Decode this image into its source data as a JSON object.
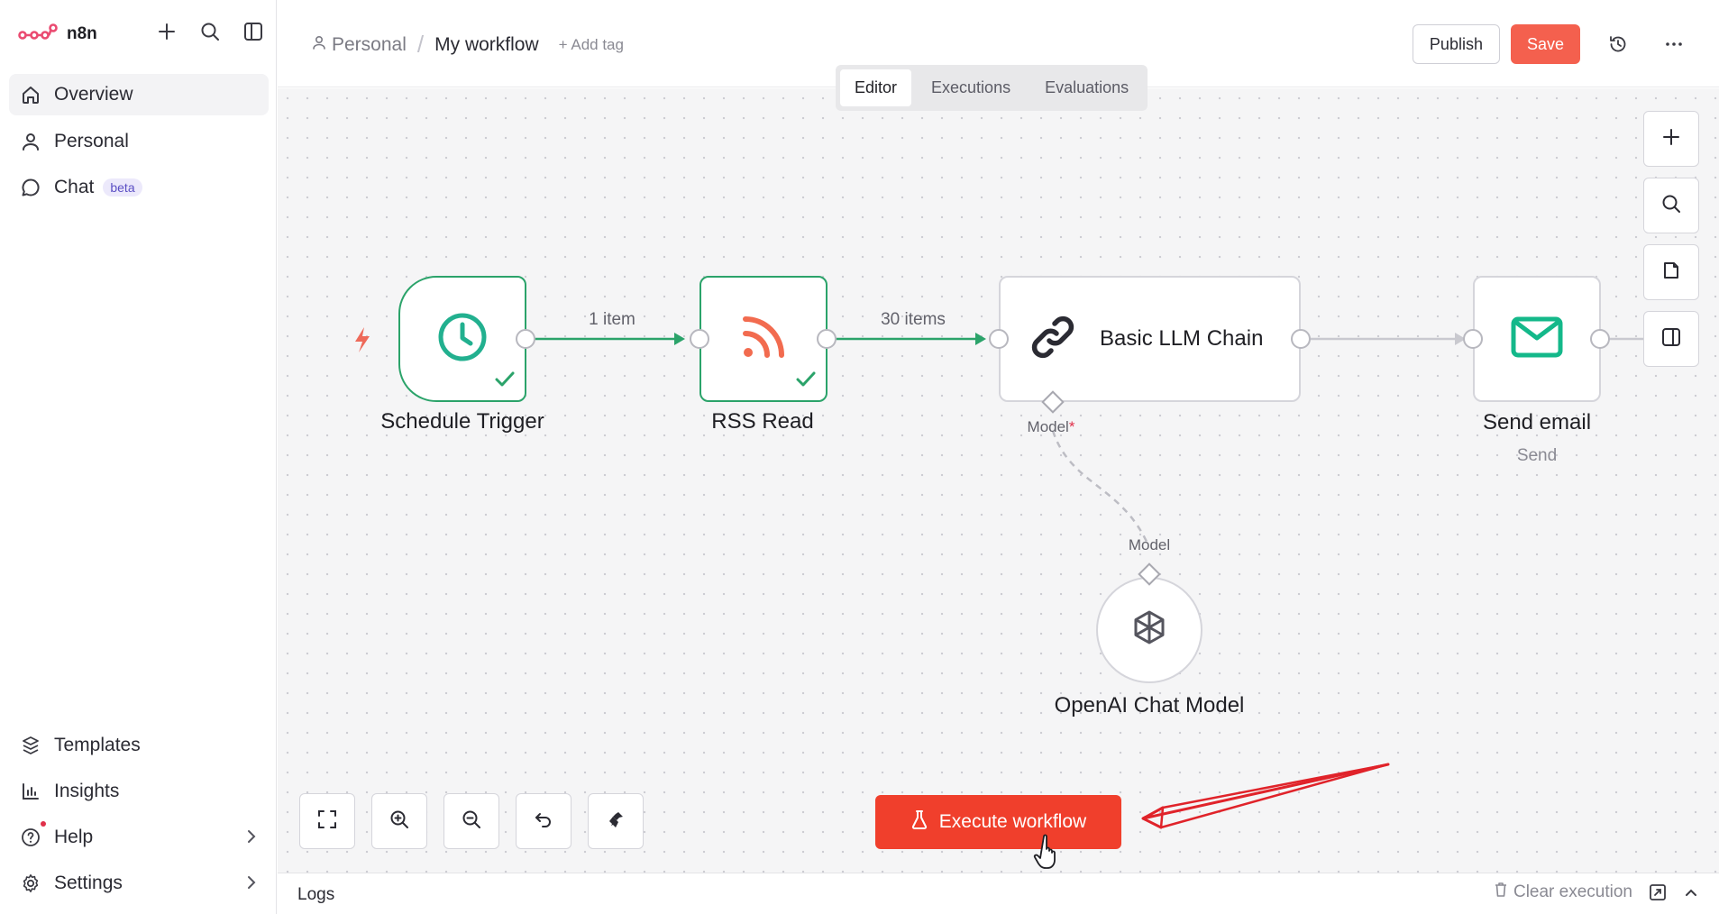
{
  "app": {
    "name": "n8n"
  },
  "sidebar": {
    "top_icons": [
      "plus-icon",
      "search-icon",
      "panel-icon"
    ],
    "items": [
      {
        "label": "Overview",
        "icon": "home-icon",
        "active": true
      },
      {
        "label": "Personal",
        "icon": "user-icon"
      },
      {
        "label": "Chat",
        "icon": "chat-icon",
        "badge": "beta"
      }
    ],
    "bottom_items": [
      {
        "label": "Templates",
        "icon": "templates-icon"
      },
      {
        "label": "Insights",
        "icon": "insights-icon"
      },
      {
        "label": "Help",
        "icon": "help-icon"
      },
      {
        "label": "Settings",
        "icon": "settings-icon"
      }
    ]
  },
  "header": {
    "breadcrumb_project": "Personal",
    "breadcrumb_separator": "/",
    "workflow_name": "My workflow",
    "add_tag": "+ Add tag",
    "publish_label": "Publish",
    "save_label": "Save"
  },
  "tabs": [
    "Editor",
    "Executions",
    "Evaluations"
  ],
  "canvas": {
    "nodes": {
      "schedule": {
        "label": "Schedule Trigger"
      },
      "rss": {
        "label": "RSS Read"
      },
      "llm": {
        "label": "Basic LLM Chain"
      },
      "email": {
        "label": "Send email",
        "sublabel": "Send"
      },
      "openai": {
        "label": "OpenAI Chat Model"
      }
    },
    "edges": {
      "schedule_to_rss": "1 item",
      "rss_to_llm": "30 items"
    },
    "model_input_label": "Model",
    "model_required_mark": "*",
    "model_output_label": "Model",
    "execute_label": "Execute workflow"
  },
  "colors": {
    "accent": "#f4604e",
    "execute": "#f03f2c",
    "success": "#2ba36a",
    "email_green": "#14b88a",
    "rss_orange": "#f26b4f"
  },
  "logs": {
    "title": "Logs",
    "clear_label": "Clear execution"
  }
}
